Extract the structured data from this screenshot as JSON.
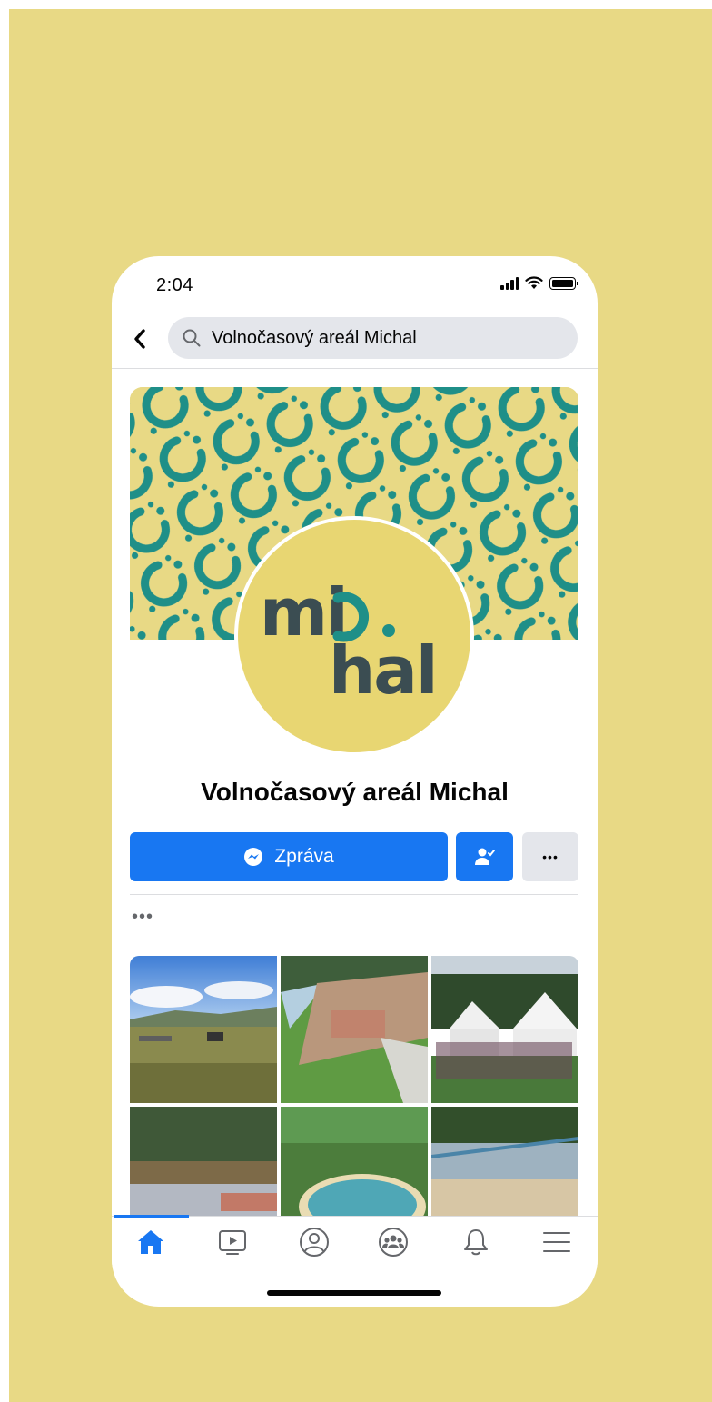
{
  "status_bar": {
    "time": "2:04"
  },
  "search": {
    "query": "Volnočasový areál Michal"
  },
  "page": {
    "name": "Volnočasový areál Michal",
    "logo_top": "mi",
    "logo_bottom": "hal"
  },
  "actions": {
    "message_label": "Zpráva",
    "more_label": "•••"
  },
  "section_more": "•••",
  "colors": {
    "facebook_blue": "#1877f2",
    "backdrop_yellow": "#e8d985",
    "teal_pattern": "#1f8f88",
    "logo_dark": "#3b4d52"
  },
  "photos": [
    {
      "name": "photo-meadow"
    },
    {
      "name": "photo-beach-crowd"
    },
    {
      "name": "photo-tents-event"
    },
    {
      "name": "photo-lake-shore"
    },
    {
      "name": "photo-aerial-lake"
    },
    {
      "name": "photo-beach-slides"
    }
  ],
  "tabs": [
    {
      "name": "home",
      "icon": "home-icon",
      "active": true
    },
    {
      "name": "watch",
      "icon": "video-icon"
    },
    {
      "name": "profile",
      "icon": "profile-icon"
    },
    {
      "name": "groups",
      "icon": "groups-icon"
    },
    {
      "name": "notifications",
      "icon": "bell-icon"
    },
    {
      "name": "menu",
      "icon": "menu-icon"
    }
  ]
}
